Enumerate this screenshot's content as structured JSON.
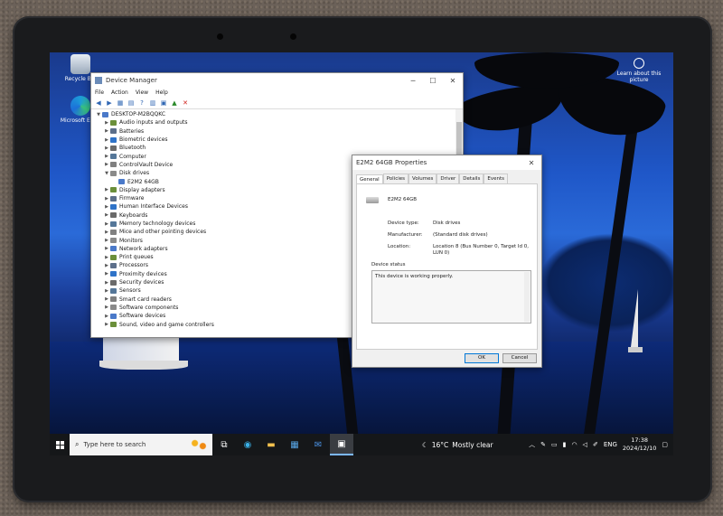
{
  "desktop": {
    "icons": [
      {
        "label": "Recycle Bin"
      },
      {
        "label": "Microsoft Edge"
      }
    ],
    "learn_more": "Learn about this picture"
  },
  "device_manager": {
    "title": "Device Manager",
    "menu": [
      "File",
      "Action",
      "View",
      "Help"
    ],
    "tree": [
      {
        "label": "DESKTOP-M2BQQKC",
        "level": 0,
        "expanded": true
      },
      {
        "label": "Audio inputs and outputs",
        "level": 1
      },
      {
        "label": "Batteries",
        "level": 1
      },
      {
        "label": "Biometric devices",
        "level": 1
      },
      {
        "label": "Bluetooth",
        "level": 1
      },
      {
        "label": "Computer",
        "level": 1
      },
      {
        "label": "ControlVault Device",
        "level": 1
      },
      {
        "label": "Disk drives",
        "level": 1,
        "expanded": true
      },
      {
        "label": "E2M2 64GB",
        "level": 2
      },
      {
        "label": "Display adapters",
        "level": 1
      },
      {
        "label": "Firmware",
        "level": 1
      },
      {
        "label": "Human Interface Devices",
        "level": 1
      },
      {
        "label": "Keyboards",
        "level": 1
      },
      {
        "label": "Memory technology devices",
        "level": 1
      },
      {
        "label": "Mice and other pointing devices",
        "level": 1
      },
      {
        "label": "Monitors",
        "level": 1
      },
      {
        "label": "Network adapters",
        "level": 1
      },
      {
        "label": "Print queues",
        "level": 1
      },
      {
        "label": "Processors",
        "level": 1
      },
      {
        "label": "Proximity devices",
        "level": 1
      },
      {
        "label": "Security devices",
        "level": 1
      },
      {
        "label": "Sensors",
        "level": 1
      },
      {
        "label": "Smart card readers",
        "level": 1
      },
      {
        "label": "Software components",
        "level": 1
      },
      {
        "label": "Software devices",
        "level": 1
      },
      {
        "label": "Sound, video and game controllers",
        "level": 1
      }
    ]
  },
  "properties": {
    "title": "E2M2 64GB Properties",
    "tabs": [
      "General",
      "Policies",
      "Volumes",
      "Driver",
      "Details",
      "Events"
    ],
    "active_tab": "General",
    "device_name": "E2M2 64GB",
    "device_type_label": "Device type:",
    "device_type_value": "Disk drives",
    "manufacturer_label": "Manufacturer:",
    "manufacturer_value": "(Standard disk drives)",
    "location_label": "Location:",
    "location_value": "Location 8 (Bus Number 0, Target Id 0, LUN 0)",
    "status_group_label": "Device status",
    "status_text": "This device is working properly.",
    "ok_label": "OK",
    "cancel_label": "Cancel"
  },
  "taskbar": {
    "search_placeholder": "Type here to search",
    "weather_temp": "16°C",
    "weather_text": "Mostly clear",
    "language": "ENG",
    "time": "17:38",
    "date": "2024/12/10"
  }
}
